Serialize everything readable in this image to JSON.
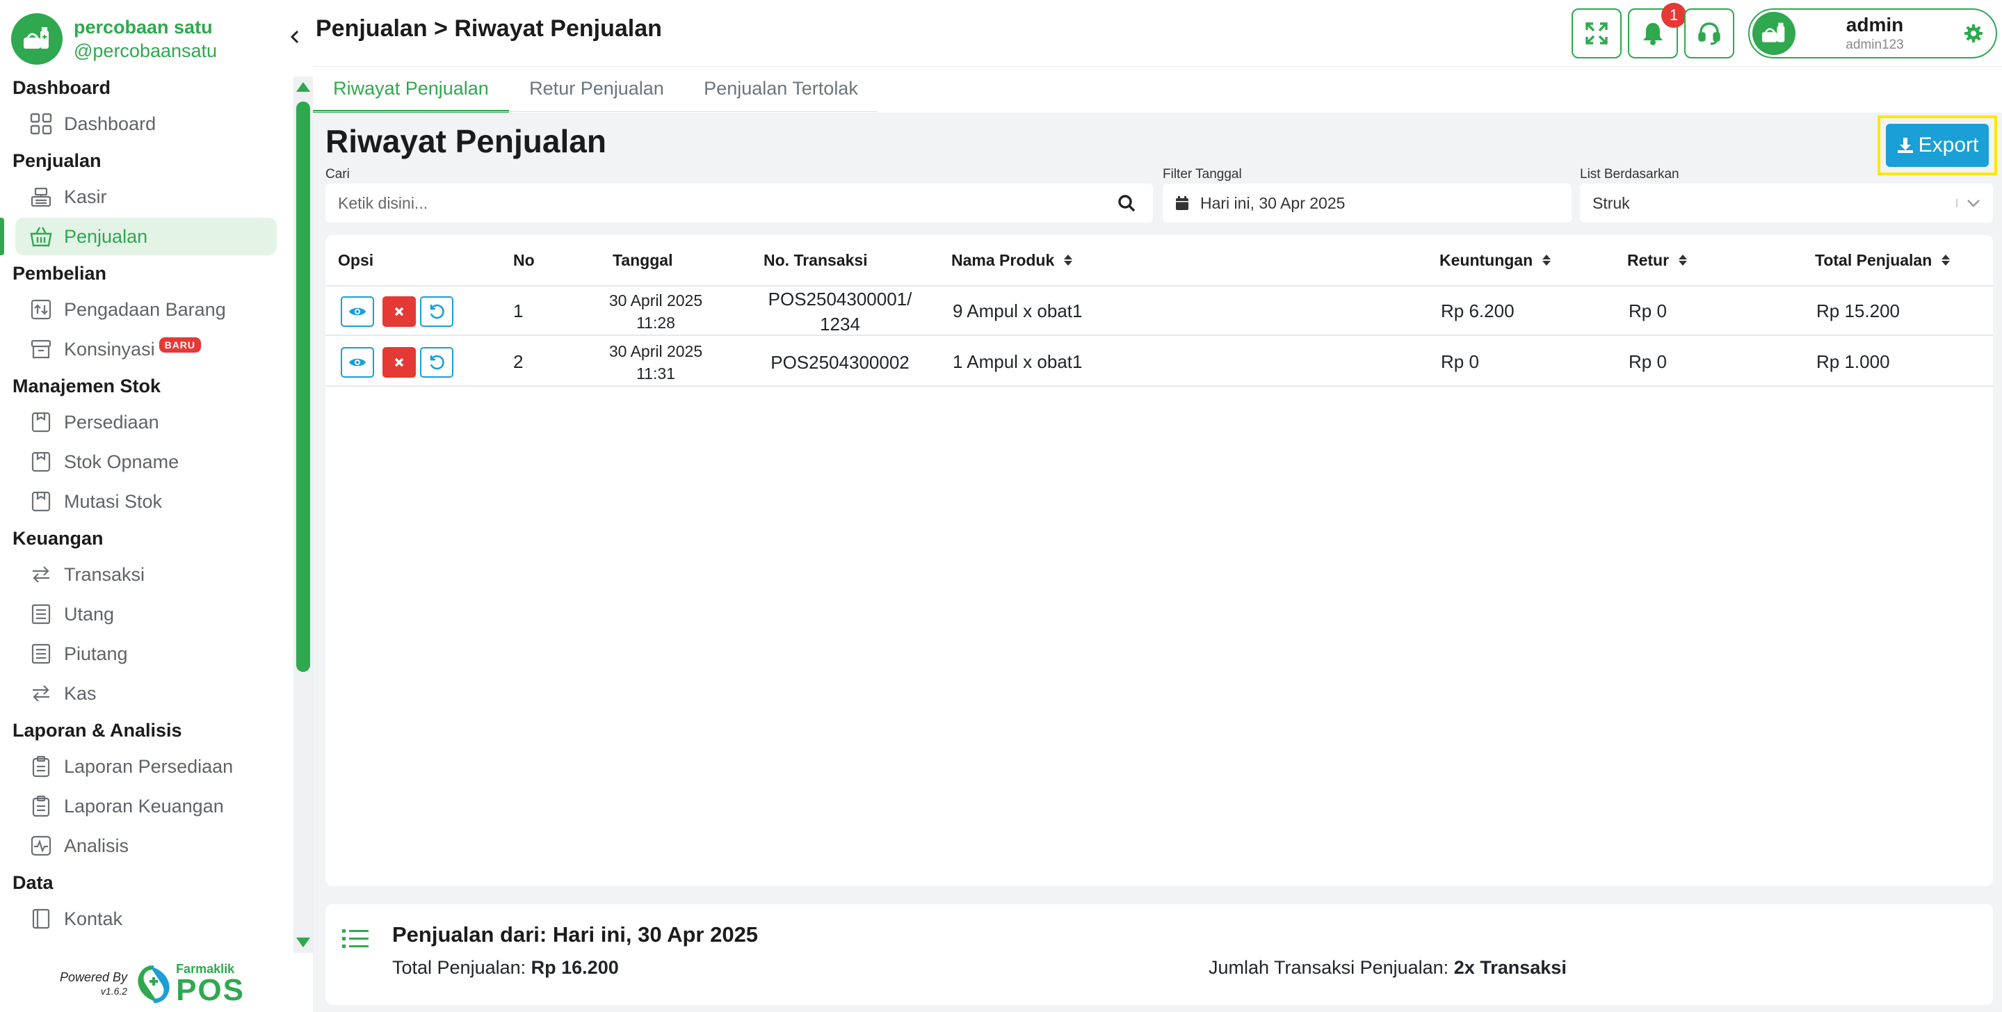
{
  "brand": {
    "name": "percobaan satu",
    "handle": "@percobaansatu"
  },
  "header": {
    "breadcrumb": "Penjualan > Riwayat Penjualan",
    "notification_count": "1",
    "user_name": "admin",
    "user_sub": "admin123"
  },
  "sidebar": {
    "sections": [
      {
        "title": "Dashboard",
        "items": [
          {
            "label": "Dashboard",
            "icon": "grid-icon"
          }
        ]
      },
      {
        "title": "Penjualan",
        "items": [
          {
            "label": "Kasir",
            "icon": "cash-register-icon"
          },
          {
            "label": "Penjualan",
            "icon": "basket-icon",
            "active": true
          }
        ]
      },
      {
        "title": "Pembelian",
        "items": [
          {
            "label": "Pengadaan Barang",
            "icon": "procurement-icon"
          },
          {
            "label": "Konsinyasi",
            "icon": "archive-icon",
            "badge": "BARU"
          }
        ]
      },
      {
        "title": "Manajemen Stok",
        "items": [
          {
            "label": "Persediaan",
            "icon": "box-icon"
          },
          {
            "label": "Stok Opname",
            "icon": "box-icon"
          },
          {
            "label": "Mutasi Stok",
            "icon": "box-icon"
          }
        ]
      },
      {
        "title": "Keuangan",
        "items": [
          {
            "label": "Transaksi",
            "icon": "transfer-icon"
          },
          {
            "label": "Utang",
            "icon": "ledger-icon"
          },
          {
            "label": "Piutang",
            "icon": "ledger-icon"
          },
          {
            "label": "Kas",
            "icon": "transfer-icon"
          }
        ]
      },
      {
        "title": "Laporan & Analisis",
        "items": [
          {
            "label": "Laporan Persediaan",
            "icon": "clipboard-icon"
          },
          {
            "label": "Laporan Keuangan",
            "icon": "clipboard-icon"
          },
          {
            "label": "Analisis",
            "icon": "pulse-icon"
          }
        ]
      },
      {
        "title": "Data",
        "items": [
          {
            "label": "Kontak",
            "icon": "contact-book-icon"
          }
        ]
      }
    ]
  },
  "powered": {
    "text": "Powered By",
    "version": "v1.6.2",
    "logo_small": "Farmaklik",
    "logo_big": "POS"
  },
  "tabs": [
    "Riwayat Penjualan",
    "Retur Penjualan",
    "Penjualan Tertolak"
  ],
  "page": {
    "title": "Riwayat Penjualan",
    "export_label": "Export",
    "search_label": "Cari",
    "search_placeholder": "Ketik disini...",
    "date_label": "Filter Tanggal",
    "date_value": "Hari ini, 30 Apr 2025",
    "list_label": "List Berdasarkan",
    "list_value": "Struk"
  },
  "table": {
    "columns": [
      "Opsi",
      "No",
      "Tanggal",
      "No. Transaksi",
      "Nama Produk",
      "Keuntungan",
      "Retur",
      "Total Penjualan"
    ],
    "rows": [
      {
        "no": "1",
        "date": "30 April 2025",
        "time": "11:28",
        "trx1": "POS2504300001/",
        "trx2": "1234",
        "product": "9 Ampul x obat1",
        "profit": "Rp 6.200",
        "retur": "Rp 0",
        "total": "Rp 15.200"
      },
      {
        "no": "2",
        "date": "30 April 2025",
        "time": "11:31",
        "trx1": "POS2504300002",
        "trx2": "",
        "product": "1 Ampul x obat1",
        "profit": "Rp 0",
        "retur": "Rp 0",
        "total": "Rp 1.000"
      }
    ]
  },
  "summary": {
    "title": "Penjualan dari: Hari ini, 30 Apr 2025",
    "total_label": "Total Penjualan:",
    "total_value": "Rp 16.200",
    "count_label": "Jumlah Transaksi Penjualan:",
    "count_value": "2x Transaksi"
  },
  "colors": {
    "accent": "#2fa84f",
    "info": "#1a9fd6",
    "danger": "#e53935",
    "highlight": "#ffe600"
  }
}
